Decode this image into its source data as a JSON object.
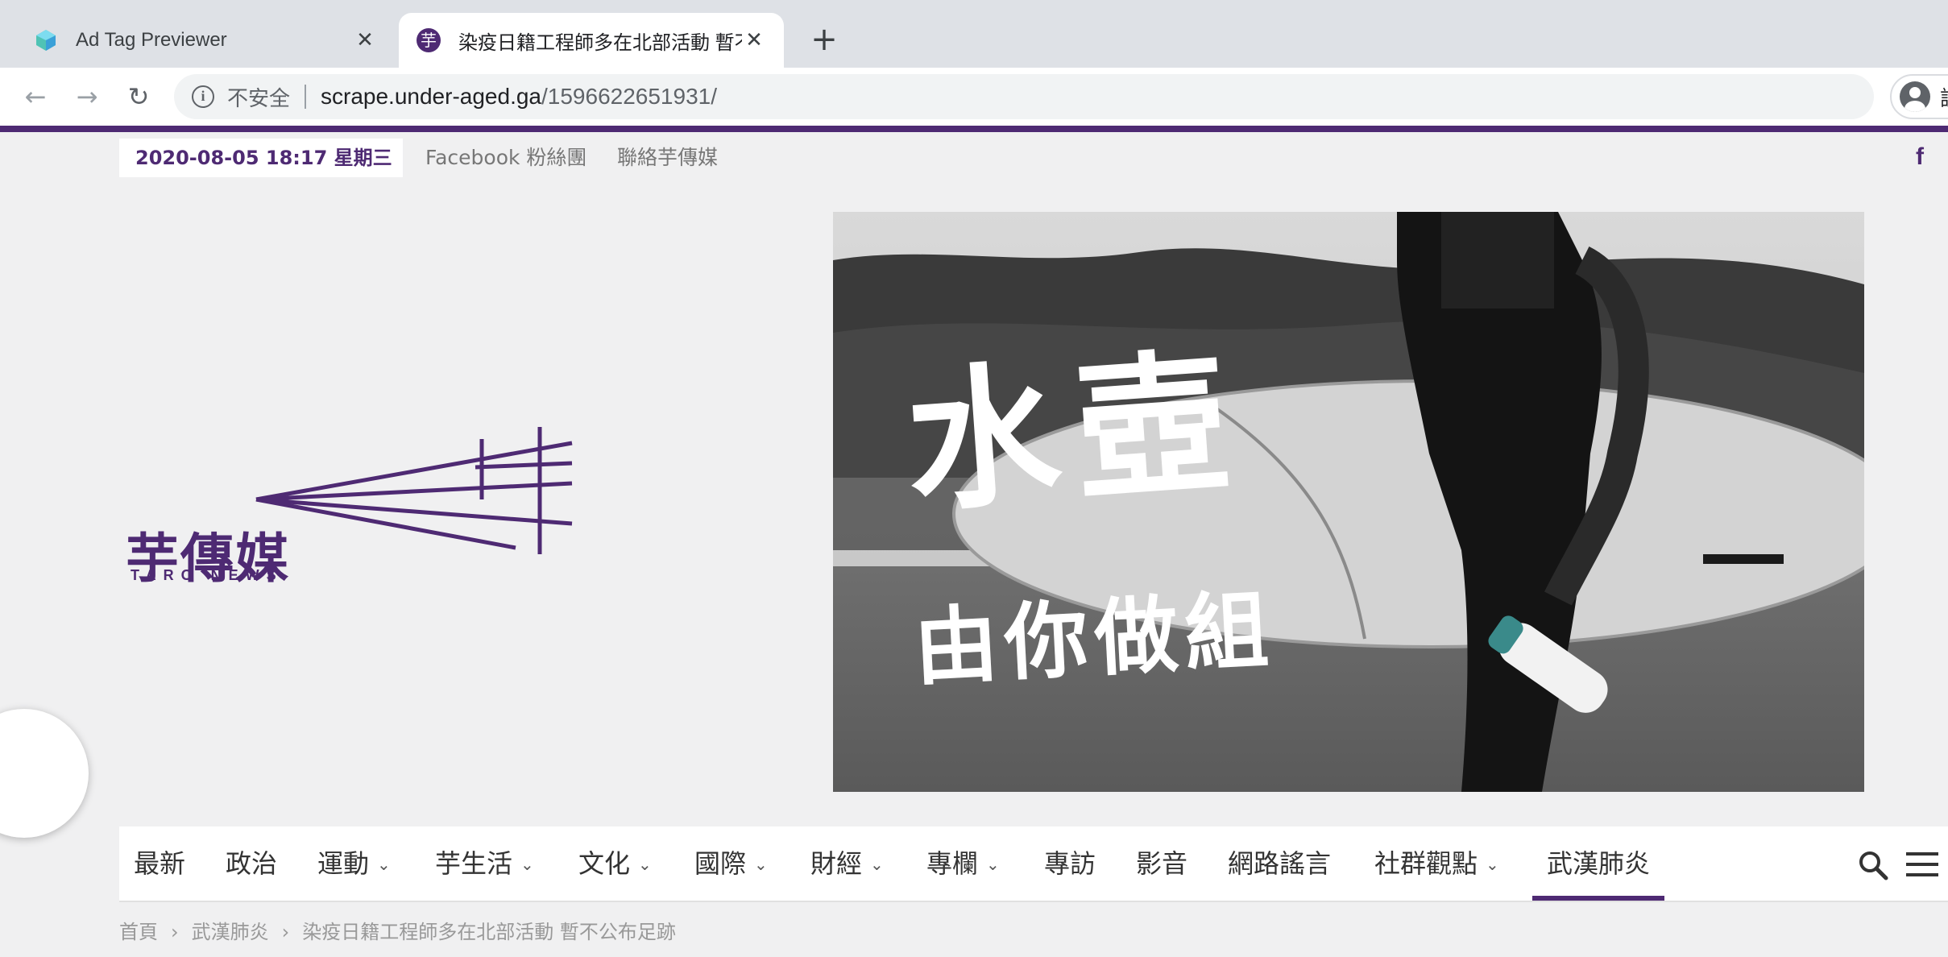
{
  "browser": {
    "tabs": [
      {
        "title": "Ad Tag Previewer",
        "icon": "ad-tag-previewer-favicon"
      },
      {
        "title": "染疫日籍工程師多在北部活動 暫不公布足跡",
        "icon": "taro-news-favicon",
        "favicon_char": "芋"
      }
    ],
    "toolbar": {
      "security_label": "不安全",
      "url_host": "scrape.under-aged.ga",
      "url_path": "/1596622651931/",
      "profile_label": "訪"
    }
  },
  "site": {
    "topbar": {
      "datetime": "2020-08-05 18:17 星期三",
      "links": [
        "Facebook 粉絲團",
        "聯絡芋傳媒"
      ],
      "social_icon": "facebook-icon",
      "social_glyph": "f"
    },
    "logo": {
      "name_cn": "芋傳媒",
      "name_en": "TARO NEWS"
    },
    "banner": {
      "line1": "水壺",
      "line2": "由你做組"
    },
    "nav": {
      "items": [
        {
          "label": "最新",
          "has_dropdown": false
        },
        {
          "label": "政治",
          "has_dropdown": false
        },
        {
          "label": "運動",
          "has_dropdown": true
        },
        {
          "label": "芋生活",
          "has_dropdown": true
        },
        {
          "label": "文化",
          "has_dropdown": true
        },
        {
          "label": "國際",
          "has_dropdown": true
        },
        {
          "label": "財經",
          "has_dropdown": true
        },
        {
          "label": "專欄",
          "has_dropdown": true
        },
        {
          "label": "專訪",
          "has_dropdown": false
        },
        {
          "label": "影音",
          "has_dropdown": false
        },
        {
          "label": "網路謠言",
          "has_dropdown": false
        },
        {
          "label": "社群觀點",
          "has_dropdown": true
        },
        {
          "label": "武漢肺炎",
          "has_dropdown": false,
          "active": true
        }
      ],
      "chevron_glyph": "⌄"
    },
    "breadcrumb": [
      "首頁",
      "武漢肺炎",
      "染疫日籍工程師多在北部活動 暫不公布足跡"
    ],
    "breadcrumb_sep": "›"
  },
  "colors": {
    "brand_purple": "#4e2a73",
    "page_bg": "#f0f0f1"
  }
}
